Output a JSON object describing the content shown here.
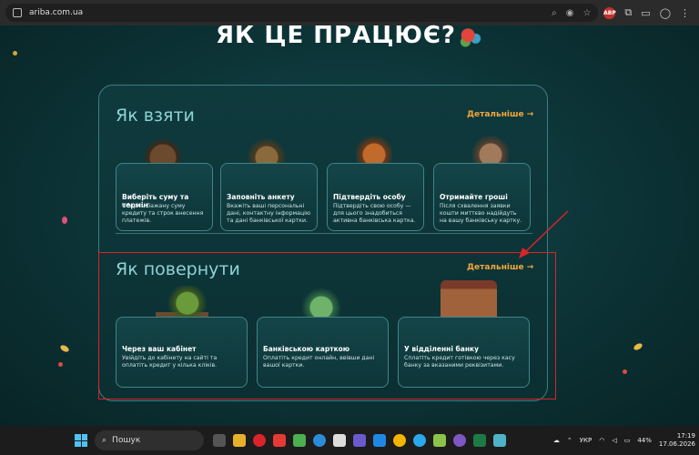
{
  "browser": {
    "url": "ariba.com.ua"
  },
  "page": {
    "heading": "ЯК ЦЕ ПРАЦЮЄ?",
    "take": {
      "title": "Як взяти",
      "more": "Детальніше →",
      "cards": [
        {
          "title": "Виберіть суму та термін",
          "text": "Оберіть бажану суму кредиту та строк внесення платежів."
        },
        {
          "title": "Заповніть анкету",
          "text": "Вкажіть ваші персональні дані, контактну інформацію та дані банківської картки."
        },
        {
          "title": "Підтвердіть особу",
          "text": "Підтвердіть свою особу — для цього знадобиться активна банківська картка."
        },
        {
          "title": "Отримайте гроші",
          "text": "Після схвалення заявки кошти миттєво надійдуть на вашу банківську картку."
        }
      ]
    },
    "repay": {
      "title": "Як повернути",
      "more": "Детальніше →",
      "cards": [
        {
          "title": "Через ваш кабінет",
          "text": "Увійдіть до кабінету на сайті та оплатіть кредит у кілька кліків."
        },
        {
          "title": "Банківською карткою",
          "text": "Оплатіть кредит онлайн, ввівши дані вашої картки."
        },
        {
          "title": "У відділенні банку",
          "text": "Сплатіть кредит готівкою через касу банку за вказаними реквізитами."
        }
      ]
    }
  },
  "taskbar": {
    "search_placeholder": "Пошук",
    "lang": "УКР",
    "battery": "44%",
    "time": "17:19",
    "date": "17.06.2026"
  }
}
